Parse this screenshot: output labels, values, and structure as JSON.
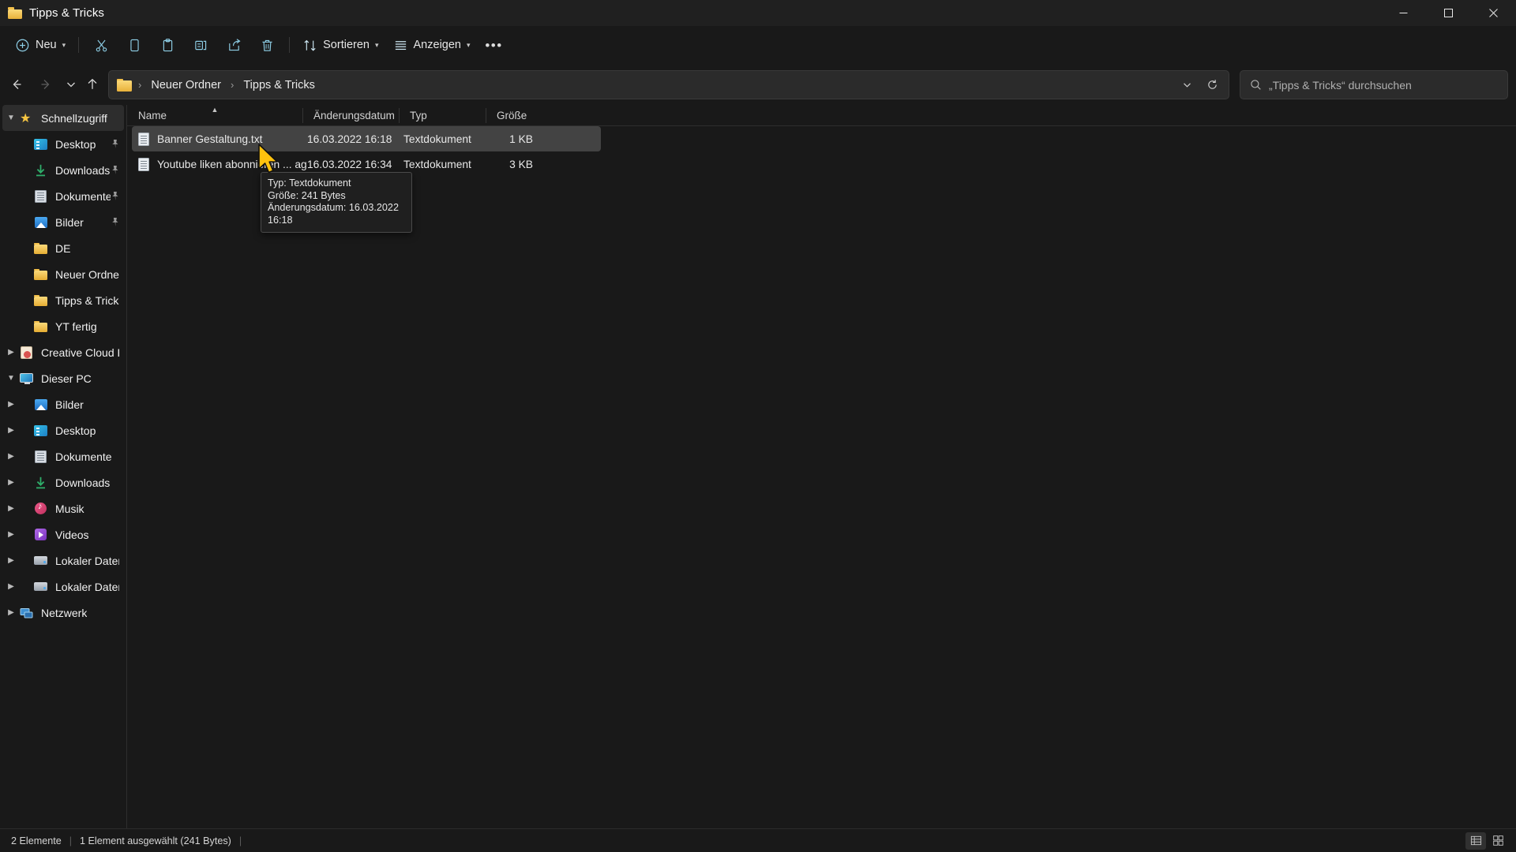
{
  "window": {
    "title": "Tipps & Tricks",
    "minimize_label": "Minimieren",
    "maximize_label": "Maximieren",
    "close_label": "Schließen"
  },
  "toolbar": {
    "new_label": "Neu",
    "cut_label": "Ausschneiden",
    "copy_label": "Kopieren",
    "paste_label": "Einfügen",
    "rename_label": "Umbenennen",
    "share_label": "Freigeben",
    "delete_label": "Löschen",
    "sort_label": "Sortieren",
    "view_label": "Anzeigen",
    "more_label": "•••"
  },
  "nav": {
    "back_label": "Zurück",
    "forward_label": "Vorwärts",
    "recent_label": "Zuletzt verwendete Speicherorte",
    "up_label": "Nach oben",
    "breadcrumbs": [
      "Neuer Ordner",
      "Tipps & Tricks"
    ],
    "separator": "›",
    "refresh_label": "Aktualisieren",
    "dropdown_label": "Vorherige Speicherorte"
  },
  "search": {
    "placeholder": "„Tipps & Tricks“ durchsuchen",
    "value": ""
  },
  "sidebar": {
    "items": [
      {
        "label": "Schnellzugriff",
        "icon": "star-icon",
        "indent": 0,
        "expander": "down",
        "pinned": false,
        "selected": true
      },
      {
        "label": "Desktop",
        "icon": "desktop-icon",
        "indent": 1,
        "expander": "none",
        "pinned": true,
        "selected": false
      },
      {
        "label": "Downloads",
        "icon": "downloads-icon",
        "indent": 1,
        "expander": "none",
        "pinned": true,
        "selected": false
      },
      {
        "label": "Dokumente",
        "icon": "documents-icon",
        "indent": 1,
        "expander": "none",
        "pinned": true,
        "selected": false
      },
      {
        "label": "Bilder",
        "icon": "pictures-icon",
        "indent": 1,
        "expander": "none",
        "pinned": true,
        "selected": false
      },
      {
        "label": "DE",
        "icon": "folder-icon",
        "indent": 1,
        "expander": "none",
        "pinned": false,
        "selected": false
      },
      {
        "label": "Neuer Ordner",
        "icon": "folder-icon",
        "indent": 1,
        "expander": "none",
        "pinned": false,
        "selected": false
      },
      {
        "label": "Tipps & Tricks",
        "icon": "folder-icon",
        "indent": 1,
        "expander": "none",
        "pinned": false,
        "selected": false
      },
      {
        "label": "YT fertig",
        "icon": "folder-icon",
        "indent": 1,
        "expander": "none",
        "pinned": false,
        "selected": false
      },
      {
        "label": "Creative Cloud Files",
        "icon": "creative-cloud-icon",
        "indent": 0,
        "expander": "right",
        "pinned": false,
        "selected": false
      },
      {
        "label": "Dieser PC",
        "icon": "this-pc-icon",
        "indent": 0,
        "expander": "down",
        "pinned": false,
        "selected": false
      },
      {
        "label": "Bilder",
        "icon": "pictures-icon",
        "indent": 1,
        "expander": "right",
        "pinned": false,
        "selected": false
      },
      {
        "label": "Desktop",
        "icon": "desktop-icon",
        "indent": 1,
        "expander": "right",
        "pinned": false,
        "selected": false
      },
      {
        "label": "Dokumente",
        "icon": "documents-icon",
        "indent": 1,
        "expander": "right",
        "pinned": false,
        "selected": false
      },
      {
        "label": "Downloads",
        "icon": "downloads-icon",
        "indent": 1,
        "expander": "right",
        "pinned": false,
        "selected": false
      },
      {
        "label": "Musik",
        "icon": "music-icon",
        "indent": 1,
        "expander": "right",
        "pinned": false,
        "selected": false
      },
      {
        "label": "Videos",
        "icon": "videos-icon",
        "indent": 1,
        "expander": "right",
        "pinned": false,
        "selected": false
      },
      {
        "label": "Lokaler Datenträge",
        "icon": "drive-icon",
        "indent": 1,
        "expander": "right",
        "pinned": false,
        "selected": false
      },
      {
        "label": "Lokaler Datenträge",
        "icon": "drive-icon",
        "indent": 1,
        "expander": "right",
        "pinned": false,
        "selected": false
      },
      {
        "label": "Netzwerk",
        "icon": "network-icon",
        "indent": 0,
        "expander": "right",
        "pinned": false,
        "selected": false
      }
    ]
  },
  "filelist": {
    "columns": [
      {
        "label": "Name",
        "sorted": true,
        "sort_dir": "asc"
      },
      {
        "label": "Änderungsdatum",
        "sorted": false,
        "sort_dir": ""
      },
      {
        "label": "Typ",
        "sorted": false,
        "sort_dir": ""
      },
      {
        "label": "Größe",
        "sorted": false,
        "sort_dir": ""
      }
    ],
    "rows": [
      {
        "name": "Banner Gestaltung.txt",
        "modified": "16.03.2022 16:18",
        "type": "Textdokument",
        "size": "1 KB",
        "selected": true
      },
      {
        "name": "Youtube liken abonnieren ... agen.txt",
        "modified": "16.03.2022 16:34",
        "type": "Textdokument",
        "size": "3 KB",
        "selected": false
      }
    ]
  },
  "tooltip": {
    "lines": [
      "Typ: Textdokument",
      "Größe: 241 Bytes",
      "Änderungsdatum: 16.03.2022 16:18"
    ]
  },
  "statusbar": {
    "item_count": "2 Elemente",
    "selection": "1 Element ausgewählt (241 Bytes)",
    "details_view_label": "Detailansicht",
    "large_icons_view_label": "Große Symbole"
  },
  "colors": {
    "accent_folder": "#e8b13a",
    "selection": "#434343",
    "background": "#191919",
    "titlebar": "#202020",
    "close_hover": "#c42b1c"
  }
}
